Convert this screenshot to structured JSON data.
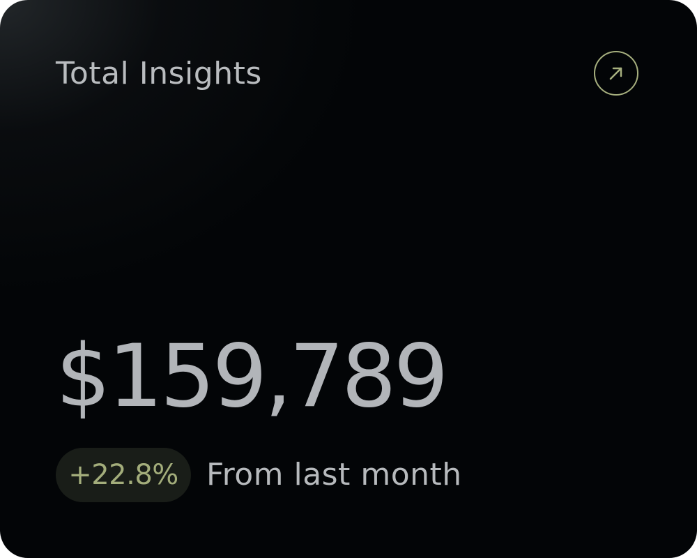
{
  "card": {
    "title": "Total Insights",
    "open_button_icon": "arrow-up-right-icon",
    "amount": "$159,789",
    "change_badge": "+22.8%",
    "caption": "From last month"
  },
  "colors": {
    "background": "#030507",
    "accent": "#a7b07f",
    "text": "#b7babd",
    "badge_background": "#191d18"
  }
}
